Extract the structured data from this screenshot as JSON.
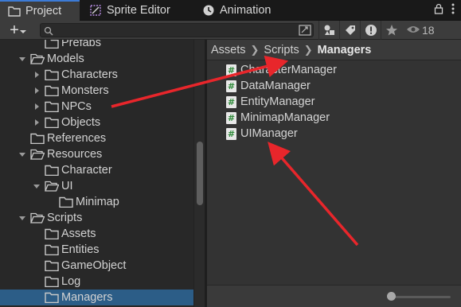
{
  "tabs": [
    {
      "label": "Project",
      "icon": "folder-icon"
    },
    {
      "label": "Sprite Editor",
      "icon": "sprite-editor-icon"
    },
    {
      "label": "Animation",
      "icon": "animation-clock-icon"
    }
  ],
  "toolbar": {
    "create_label": "+",
    "search_placeholder": "",
    "visibility_count": "18"
  },
  "tree": [
    {
      "label": "Prefabs",
      "indent": 2,
      "arrow": "none"
    },
    {
      "label": "Models",
      "indent": 1,
      "arrow": "open"
    },
    {
      "label": "Characters",
      "indent": 2,
      "arrow": "closed"
    },
    {
      "label": "Monsters",
      "indent": 2,
      "arrow": "closed"
    },
    {
      "label": "NPCs",
      "indent": 2,
      "arrow": "closed"
    },
    {
      "label": "Objects",
      "indent": 2,
      "arrow": "closed"
    },
    {
      "label": "References",
      "indent": 1,
      "arrow": "none"
    },
    {
      "label": "Resources",
      "indent": 1,
      "arrow": "open"
    },
    {
      "label": "Character",
      "indent": 2,
      "arrow": "none"
    },
    {
      "label": "UI",
      "indent": 2,
      "arrow": "open"
    },
    {
      "label": "Minimap",
      "indent": 3,
      "arrow": "none"
    },
    {
      "label": "Scripts",
      "indent": 1,
      "arrow": "open"
    },
    {
      "label": "Assets",
      "indent": 2,
      "arrow": "none"
    },
    {
      "label": "Entities",
      "indent": 2,
      "arrow": "none"
    },
    {
      "label": "GameObject",
      "indent": 2,
      "arrow": "none"
    },
    {
      "label": "Log",
      "indent": 2,
      "arrow": "none"
    },
    {
      "label": "Managers",
      "indent": 2,
      "arrow": "none",
      "selected": true
    }
  ],
  "breadcrumb": {
    "items": [
      "Assets",
      "Scripts"
    ],
    "current": "Managers"
  },
  "files": [
    "CharacterManager",
    "DataManager",
    "EntityManager",
    "MinimapManager",
    "UIManager"
  ],
  "colors": {
    "annotation_arrow": "#e8262b",
    "selection": "#2c5d87",
    "active_tab_accent": "#3c7bd6",
    "script_icon_hash": "#2f8a3a"
  }
}
